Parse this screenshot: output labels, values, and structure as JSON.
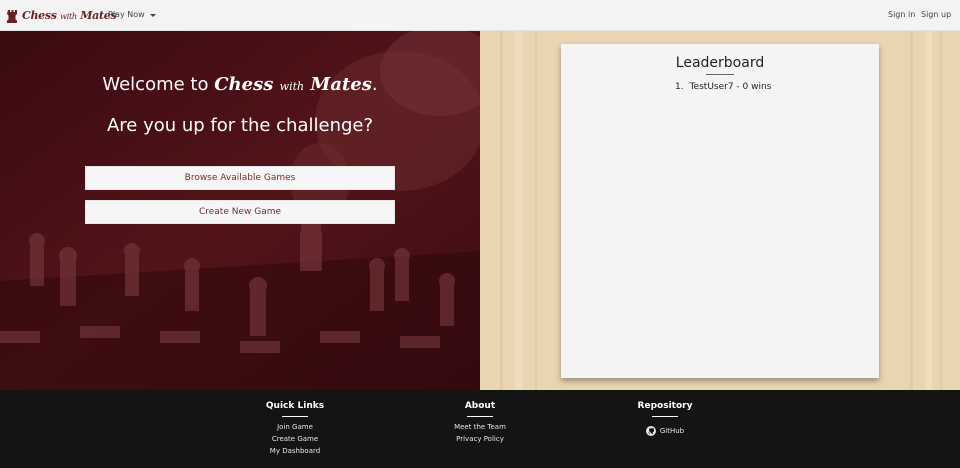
{
  "navbar": {
    "brand": {
      "main1": "Chess",
      "small": "with",
      "main2": "Mates"
    },
    "play_now": "Play Now",
    "sign_in": "Sign in",
    "sign_up": "Sign up"
  },
  "hero": {
    "welcome_prefix": "Welcome to",
    "welcome_suffix": ".",
    "challenge": "Are you up for the challenge?",
    "browse_button": "Browse Available Games",
    "create_button": "Create New Game"
  },
  "leaderboard": {
    "title": "Leaderboard",
    "entries": [
      {
        "rank": "1.",
        "text": "TestUser7 - 0 wins"
      }
    ]
  },
  "footer": {
    "quick_links": {
      "title": "Quick Links",
      "links": [
        "Join Game",
        "Create Game",
        "My Dashboard"
      ]
    },
    "about": {
      "title": "About",
      "links": [
        "Meet the Team",
        "Privacy Policy"
      ]
    },
    "repository": {
      "title": "Repository",
      "github": "GitHub"
    }
  },
  "colors": {
    "brand": "#6b1f23",
    "hero_overlay": "#4a1117",
    "footer_bg": "#141414",
    "wood": "#ead5b3"
  },
  "icons": {
    "brand": "rook-icon",
    "play_now": "chevron-down-icon",
    "github": "github-icon"
  }
}
